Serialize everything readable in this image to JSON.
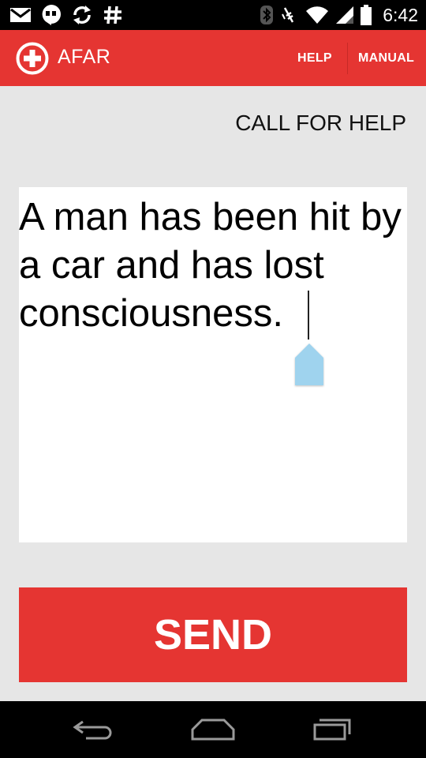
{
  "status_bar": {
    "time": "6:42",
    "left_icons": [
      "gmail-icon",
      "hangouts-icon",
      "sync-icon",
      "hashtag-icon"
    ],
    "right_icons": [
      "bluetooth-icon",
      "vibrate-icon",
      "wifi-icon",
      "signal-icon",
      "battery-icon"
    ]
  },
  "action_bar": {
    "title": "AFAR",
    "logo": "plus-circle-icon",
    "actions": {
      "help": "HELP",
      "manual": "MANUAL"
    },
    "color": "#e53532"
  },
  "main": {
    "heading": "CALL FOR HELP",
    "message": {
      "value": "A man has been hit by a car and has lost consciousness."
    },
    "send_label": "SEND"
  },
  "nav_bar": {
    "buttons": [
      "back-icon",
      "home-icon",
      "recent-apps-icon"
    ]
  },
  "colors": {
    "accent": "#e53532",
    "background": "#e6e6e6",
    "handle": "#9fd3ee"
  }
}
